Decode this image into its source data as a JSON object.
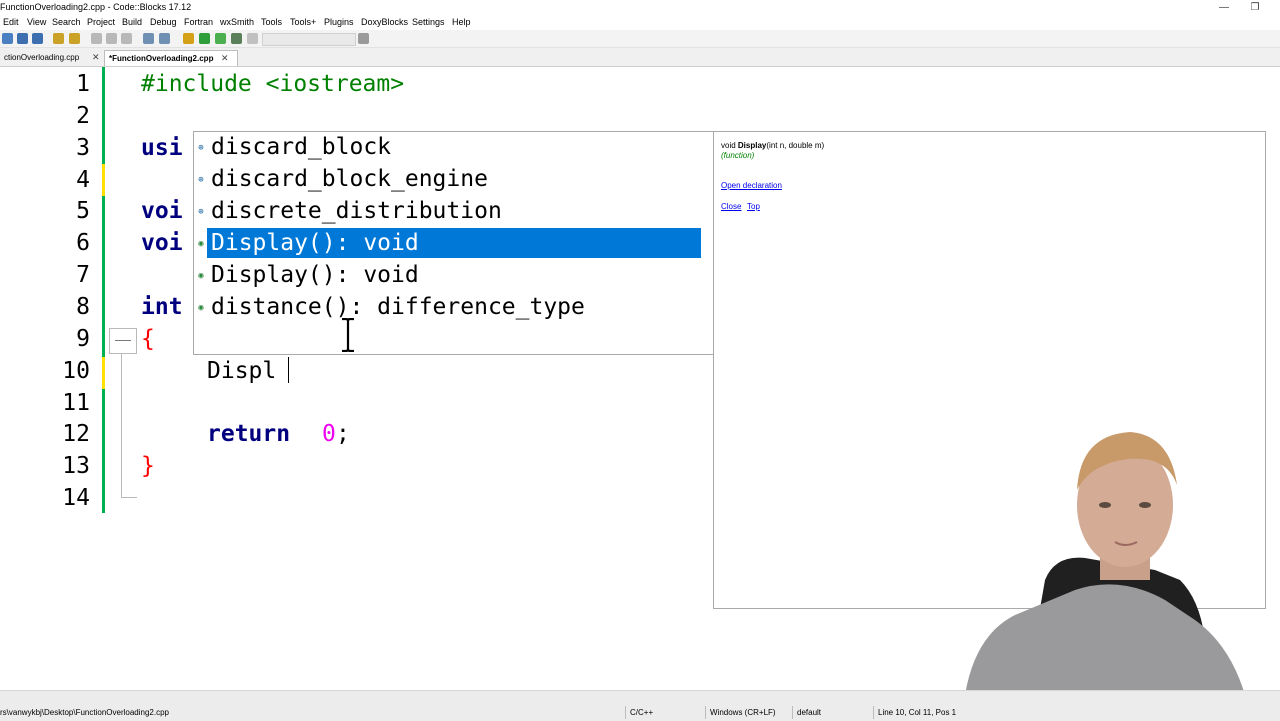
{
  "window": {
    "title": "FunctionOverloading2.cpp - Code::Blocks 17.12",
    "minimize_glyph": "—",
    "restore_glyph": "❐"
  },
  "menu": [
    "Edit",
    "View",
    "Search",
    "Project",
    "Build",
    "Debug",
    "Fortran",
    "wxSmith",
    "Tools",
    "Tools+",
    "Plugins",
    "DoxyBlocks",
    "Settings",
    "Help"
  ],
  "tabs": [
    {
      "label": "ctionOverloading.cpp",
      "active": false,
      "close": "✕"
    },
    {
      "label": "*FunctionOverloading2.cpp",
      "active": true,
      "close": "✕"
    }
  ],
  "editor": {
    "line_numbers": [
      "1",
      "2",
      "3",
      "4",
      "5",
      "6",
      "7",
      "8",
      "9",
      "10",
      "11",
      "12",
      "13",
      "14"
    ],
    "line1_directive": "#include <iostream>",
    "line3_visible": "usi",
    "line5_visible": "voi",
    "line6_visible": "voi",
    "line8_visible": "int",
    "line9_brace": "{",
    "line10_text": "Displ",
    "line12_keyword": "return",
    "line12_number": "0",
    "line12_end": ";",
    "line13_brace": "}"
  },
  "autocomplete": {
    "items": [
      {
        "icon": "class-icon",
        "label": "discard_block",
        "selected": false
      },
      {
        "icon": "class-icon",
        "label": "discard_block_engine",
        "selected": false
      },
      {
        "icon": "class-icon",
        "label": "discrete_distribution",
        "selected": false
      },
      {
        "icon": "function-icon",
        "label": "Display(): void",
        "selected": true
      },
      {
        "icon": "function-icon",
        "label": "Display(): void",
        "selected": false
      },
      {
        "icon": "function-icon",
        "label": "distance(): difference_type",
        "selected": false
      }
    ]
  },
  "doc": {
    "sig_prefix": "void ",
    "sig_name": "Display",
    "sig_params": "(int n, double m)",
    "kind": "(function)",
    "open_declaration": "Open declaration",
    "close": "Close",
    "top": "Top"
  },
  "status": {
    "file_path": "rs\\vanwykbj\\Desktop\\FunctionOverloading2.cpp",
    "language": "C/C++",
    "line_endings": "Windows (CR+LF)",
    "encoding": "default",
    "position": "Line 10, Col 11, Pos 1"
  },
  "colors": {
    "keyword": "#00007f",
    "preprocessor": "#008000",
    "number": "#f000f0",
    "brace": "#ff0000",
    "selection": "#0078d7",
    "change_bar_saved": "#00b050",
    "change_bar_modified": "#ffe000"
  }
}
